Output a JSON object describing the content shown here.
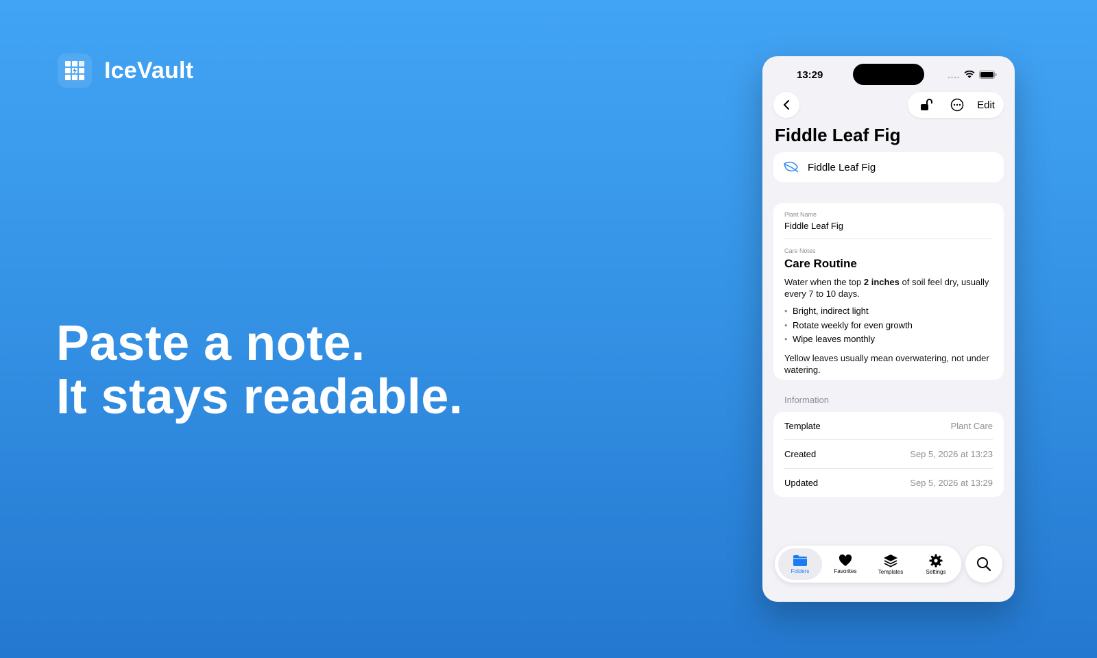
{
  "brand": {
    "name": "IceVault",
    "logo_icon": "ice-cube-grid-icon"
  },
  "headline": {
    "line1": "Paste a note.",
    "line2": "It stays readable."
  },
  "phone": {
    "status": {
      "time": "13:29"
    },
    "nav": {
      "edit_label": "Edit",
      "icons": [
        "chevron-left-icon",
        "unlock-icon",
        "more-icon"
      ]
    },
    "title": "Fiddle Leaf Fig",
    "name_row": {
      "icon": "leaf-icon",
      "text": "Fiddle Leaf Fig"
    },
    "fields": {
      "plant_name_label": "Plant Name",
      "plant_name_value": "Fiddle Leaf Fig",
      "care_notes_label": "Care Notes",
      "care_heading": "Care Routine",
      "para1_pre": "Water when the top ",
      "para1_bold": "2 inches",
      "para1_post": " of soil feel dry, usually every 7 to 10 days.",
      "bullets": [
        "Bright, indirect light",
        "Rotate weekly for even growth",
        "Wipe leaves monthly"
      ],
      "para2": "Yellow leaves usually mean overwatering, not under watering."
    },
    "information": {
      "heading": "Information",
      "rows": [
        {
          "label": "Template",
          "value": "Plant Care"
        },
        {
          "label": "Created",
          "value": "Sep 5, 2026 at 13:23"
        },
        {
          "label": "Updated",
          "value": "Sep 5, 2026 at 13:29"
        }
      ]
    },
    "tabs": [
      {
        "label": "Folders",
        "icon": "folder-icon",
        "active": true
      },
      {
        "label": "Favorites",
        "icon": "heart-icon",
        "active": false
      },
      {
        "label": "Templates",
        "icon": "layers-icon",
        "active": false
      },
      {
        "label": "Settings",
        "icon": "gear-icon",
        "active": false
      }
    ],
    "search_icon": "search-icon",
    "accent_color": "#1a7bf2"
  }
}
